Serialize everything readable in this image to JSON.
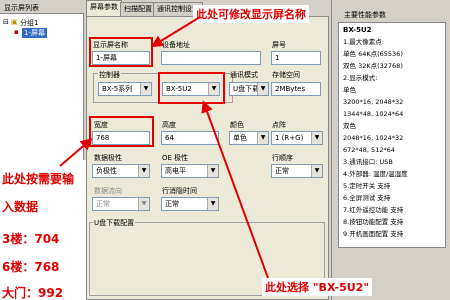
{
  "left_panel": {
    "header": "显示屏列表",
    "tree_group": "分组1",
    "tree_screen": "1-屏幕"
  },
  "tabs": [
    {
      "label": "屏幕参数"
    },
    {
      "label": "扫描配置"
    },
    {
      "label": "通讯控制设置"
    }
  ],
  "form": {
    "screen_name_label": "显示屏名称",
    "screen_name_value": "1-屏幕",
    "device_addr_label": "设备地址",
    "device_addr_value": "",
    "screen_no_label": "屏号",
    "screen_no_value": "1",
    "controller_label": "控制器",
    "controller_series": "BX-5系列",
    "controller_model": "BX-5U2",
    "comm_mode_label": "通讯模式",
    "comm_mode_value": "U盘下载",
    "storage_label": "存储空间",
    "storage_value": "2MBytes",
    "width_label": "宽度",
    "width_value": "768",
    "height_label": "高度",
    "height_value": "64",
    "color_label": "颜色",
    "color_value": "单色",
    "pixel_label": "点阵",
    "pixel_value": "1 (R+G)",
    "data_pol_label": "数据极性",
    "data_pol_value": "负极性",
    "oe_pol_label": "OE 极性",
    "oe_pol_value": "高电平",
    "row_order_label": "行顺序",
    "row_order_value": "正常",
    "data_dir_label": "数据流向",
    "data_dir_value": "正常",
    "blank_label": "行消隐时间",
    "blank_value": "正常",
    "udisk_label": "U盘下载配置"
  },
  "right_panel": {
    "header": "主要性能参数",
    "model": "BX-5U2",
    "lines": [
      "1.最大像素点:",
      "单色 64K点(65536)",
      "双色 32K点(32768)",
      "2.显示模式:",
      "单色",
      "3200*16, 2048*32",
      "1344*48, 1024*64",
      "双色",
      "2048*16, 1024*32",
      "672*48, 512*64",
      "3.通讯接口: USB",
      "4.外部器: 温度/温湿度",
      "5.定时开关 支持",
      "6.全屏测试 支持",
      "7.红外遥控功能 支持",
      "8.按钮功能配置 支持",
      "9.开机画面配置 支持"
    ]
  },
  "annotations": {
    "top_callout": "此处可修改显示屏名称",
    "left_callout_1": "此处按需要输",
    "left_callout_2": "入数据",
    "floor_3": "3楼：704",
    "floor_6": "6楼：768",
    "floor_hall": "大门：992",
    "bottom_callout": "此处选择 \"BX-5U2\""
  },
  "colors": {
    "annotation_red": "#e00000",
    "window_gray": "#d4d0c8"
  }
}
